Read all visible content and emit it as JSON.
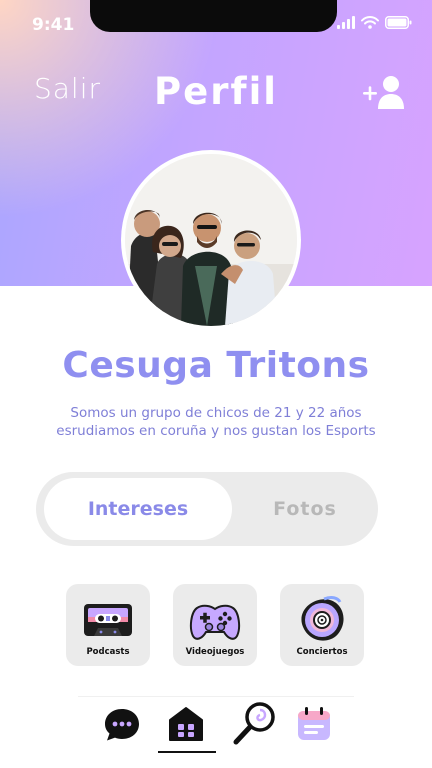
{
  "status_bar": {
    "time": "9:41"
  },
  "header": {
    "back_label": "Salir",
    "title": "Perfil"
  },
  "profile": {
    "name": "Cesuga Tritons",
    "description_line1": "Somos un grupo de chicos de 21 y 22 años",
    "description_line2": "esrudiamos en coruña y nos gustan los Esports"
  },
  "tabs": [
    {
      "label": "Intereses",
      "active": true
    },
    {
      "label": "Fotos",
      "active": false
    }
  ],
  "interests": [
    {
      "label": "Podcasts",
      "icon": "cassette-icon"
    },
    {
      "label": "Videojuegos",
      "icon": "gamepad-icon"
    },
    {
      "label": "Conciertos",
      "icon": "vinyl-icon"
    }
  ],
  "bottom_nav": [
    {
      "icon": "chat-icon"
    },
    {
      "icon": "home-icon",
      "active": true
    },
    {
      "icon": "search-icon"
    },
    {
      "icon": "calendar-icon"
    }
  ],
  "colors": {
    "accent": "#8f8ff0",
    "hero_start": "#a9a6ff",
    "hero_end": "#d7a3ff",
    "tab_bg": "#ebebeb"
  }
}
